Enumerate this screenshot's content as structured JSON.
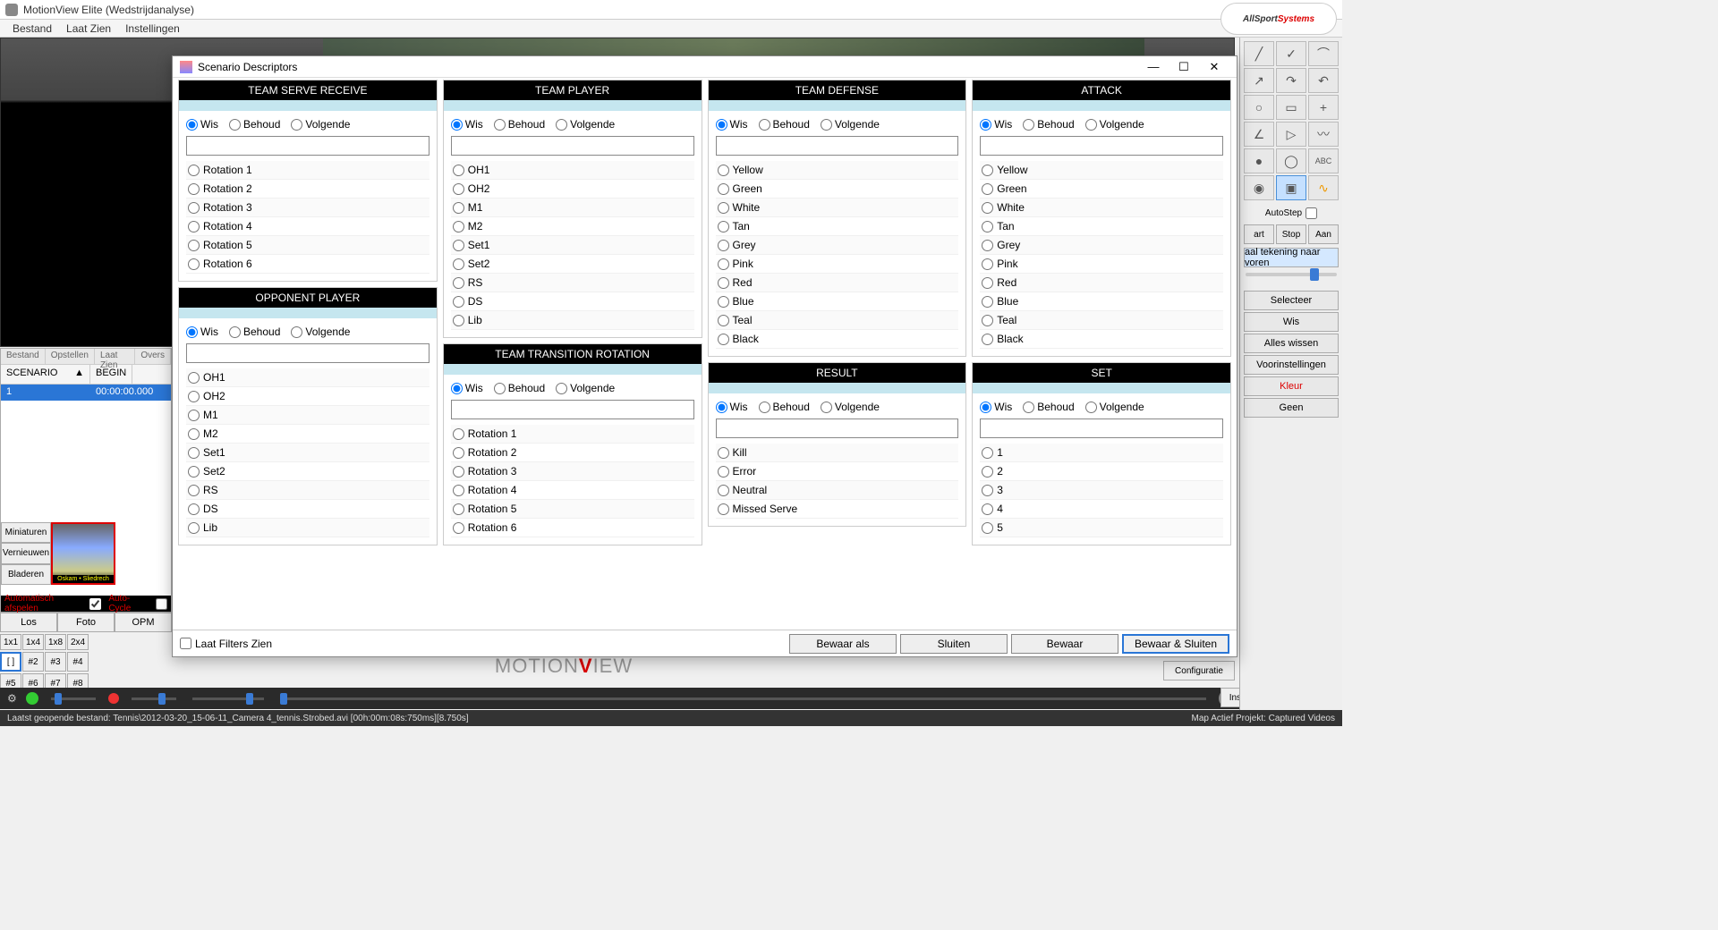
{
  "window": {
    "title": "MotionView Elite (Wedstrijdanalyse)",
    "min": "—",
    "max": "☐",
    "close": "✕"
  },
  "menubar": [
    "Bestand",
    "Laat Zien",
    "Instellingen"
  ],
  "logo": {
    "part1": "AllSport",
    "part2": "Systems"
  },
  "righttool": {
    "autostep": "AutoStep",
    "row1": [
      "art",
      "Stop",
      "Aan"
    ],
    "bring_fwd": "aal tekening naar voren",
    "buttons": [
      "Selecteer",
      "Wis",
      "Alles wissen",
      "Voorinstellingen",
      "Kleur",
      "Geen"
    ]
  },
  "leftpanel": {
    "tabs": [
      "Bestand",
      "Opstellen",
      "Laat Zien",
      "Overs"
    ],
    "hdr_scenario": "SCENARIO",
    "hdr_begin": "BEGIN",
    "row_num": "1",
    "row_time": "00:00:00.000",
    "thumb_btns": [
      "Miniaturen",
      "Vernieuwen",
      "Bladeren"
    ],
    "thumb_txt": "Oskam • Sliedrech",
    "auto_play": "Automatisch afspelen",
    "auto_cycle": "Auto-Cycle"
  },
  "bottomtabs": {
    "tabs": [
      "Los",
      "Foto",
      "OPM"
    ],
    "grid": [
      "1x1",
      "1x4",
      "1x8",
      "2x4"
    ],
    "nums1": [
      "[ ]",
      "#2",
      "#3",
      "#4"
    ],
    "nums2": [
      "#5",
      "#6",
      "#7",
      "#8"
    ]
  },
  "lowerbtns": {
    "config": "Configuratie",
    "instr": "Instructie"
  },
  "watermark": {
    "p1": "MOTION",
    "v": "V",
    "p2": "IEW"
  },
  "statusbar": {
    "left": "Laatst geopende bestand: Tennis\\2012-03-20_15-06-11_Camera 4_tennis.Strobed.avi  [00h:00m:08s:750ms][8.750s]",
    "right": "Map Actief Projekt: Captured Videos"
  },
  "modal": {
    "title": "Scenario Descriptors",
    "laat_filters": "Laat Filters Zien",
    "btn_saveas": "Bewaar als",
    "btn_close": "Sluiten",
    "btn_save": "Bewaar",
    "btn_saveclose": "Bewaar & Sluiten",
    "radio": {
      "wis": "Wis",
      "behoud": "Behoud",
      "volgende": "Volgende"
    },
    "panels": [
      {
        "title": "TEAM SERVE RECEIVE",
        "opts": [
          "Rotation 1",
          "Rotation 2",
          "Rotation 3",
          "Rotation 4",
          "Rotation 5",
          "Rotation 6"
        ]
      },
      {
        "title": "TEAM PLAYER",
        "opts": [
          "OH1",
          "OH2",
          "M1",
          "M2",
          "Set1",
          "Set2",
          "RS",
          "DS",
          "Lib"
        ]
      },
      {
        "title": "TEAM DEFENSE",
        "opts": [
          "Yellow",
          "Green",
          "White",
          "Tan",
          "Grey",
          "Pink",
          "Red",
          "Blue",
          "Teal",
          "Black"
        ]
      },
      {
        "title": "ATTACK",
        "opts": [
          "Yellow",
          "Green",
          "White",
          "Tan",
          "Grey",
          "Pink",
          "Red",
          "Blue",
          "Teal",
          "Black"
        ]
      },
      {
        "title": "OPPONENT PLAYER",
        "opts": [
          "OH1",
          "OH2",
          "M1",
          "M2",
          "Set1",
          "Set2",
          "RS",
          "DS",
          "Lib"
        ]
      },
      {
        "title": "TEAM TRANSITION ROTATION",
        "opts": [
          "Rotation 1",
          "Rotation 2",
          "Rotation 3",
          "Rotation 4",
          "Rotation 5",
          "Rotation 6"
        ]
      },
      {
        "title": "RESULT",
        "opts": [
          "Kill",
          "Error",
          "Neutral",
          "Missed Serve"
        ]
      },
      {
        "title": "SET",
        "opts": [
          "1",
          "2",
          "3",
          "4",
          "5"
        ]
      }
    ]
  }
}
